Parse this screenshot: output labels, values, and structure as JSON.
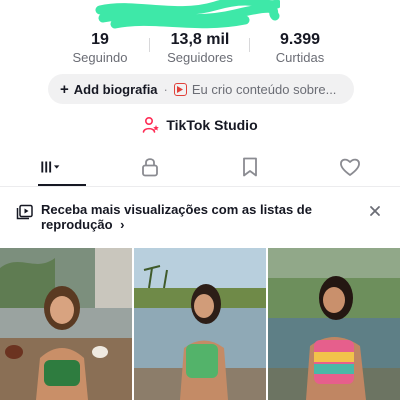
{
  "stats": [
    {
      "value": "19",
      "label": "Seguindo"
    },
    {
      "value": "13,8 mil",
      "label": "Seguidores"
    },
    {
      "value": "9.399",
      "label": "Curtidas"
    }
  ],
  "bio": {
    "add_label": "Add biografia",
    "separator": "·",
    "creator_text": "Eu crio conteúdo sobre..."
  },
  "studio": {
    "label": "TikTok Studio"
  },
  "tabs": [
    {
      "name": "videos",
      "icon": "grid-icon",
      "active": true
    },
    {
      "name": "private",
      "icon": "lock-icon",
      "active": false
    },
    {
      "name": "saved",
      "icon": "bookmark-icon",
      "active": false
    },
    {
      "name": "liked",
      "icon": "heart-icon",
      "active": false
    }
  ],
  "banner": {
    "text": "Receba mais visualizações com as listas de reprodução",
    "arrow": "›"
  },
  "colors": {
    "redaction": "#3ee8a8",
    "accent": "#fe2c55",
    "text": "#161823",
    "muted": "#6b6d75",
    "pill": "#f1f1f2"
  }
}
